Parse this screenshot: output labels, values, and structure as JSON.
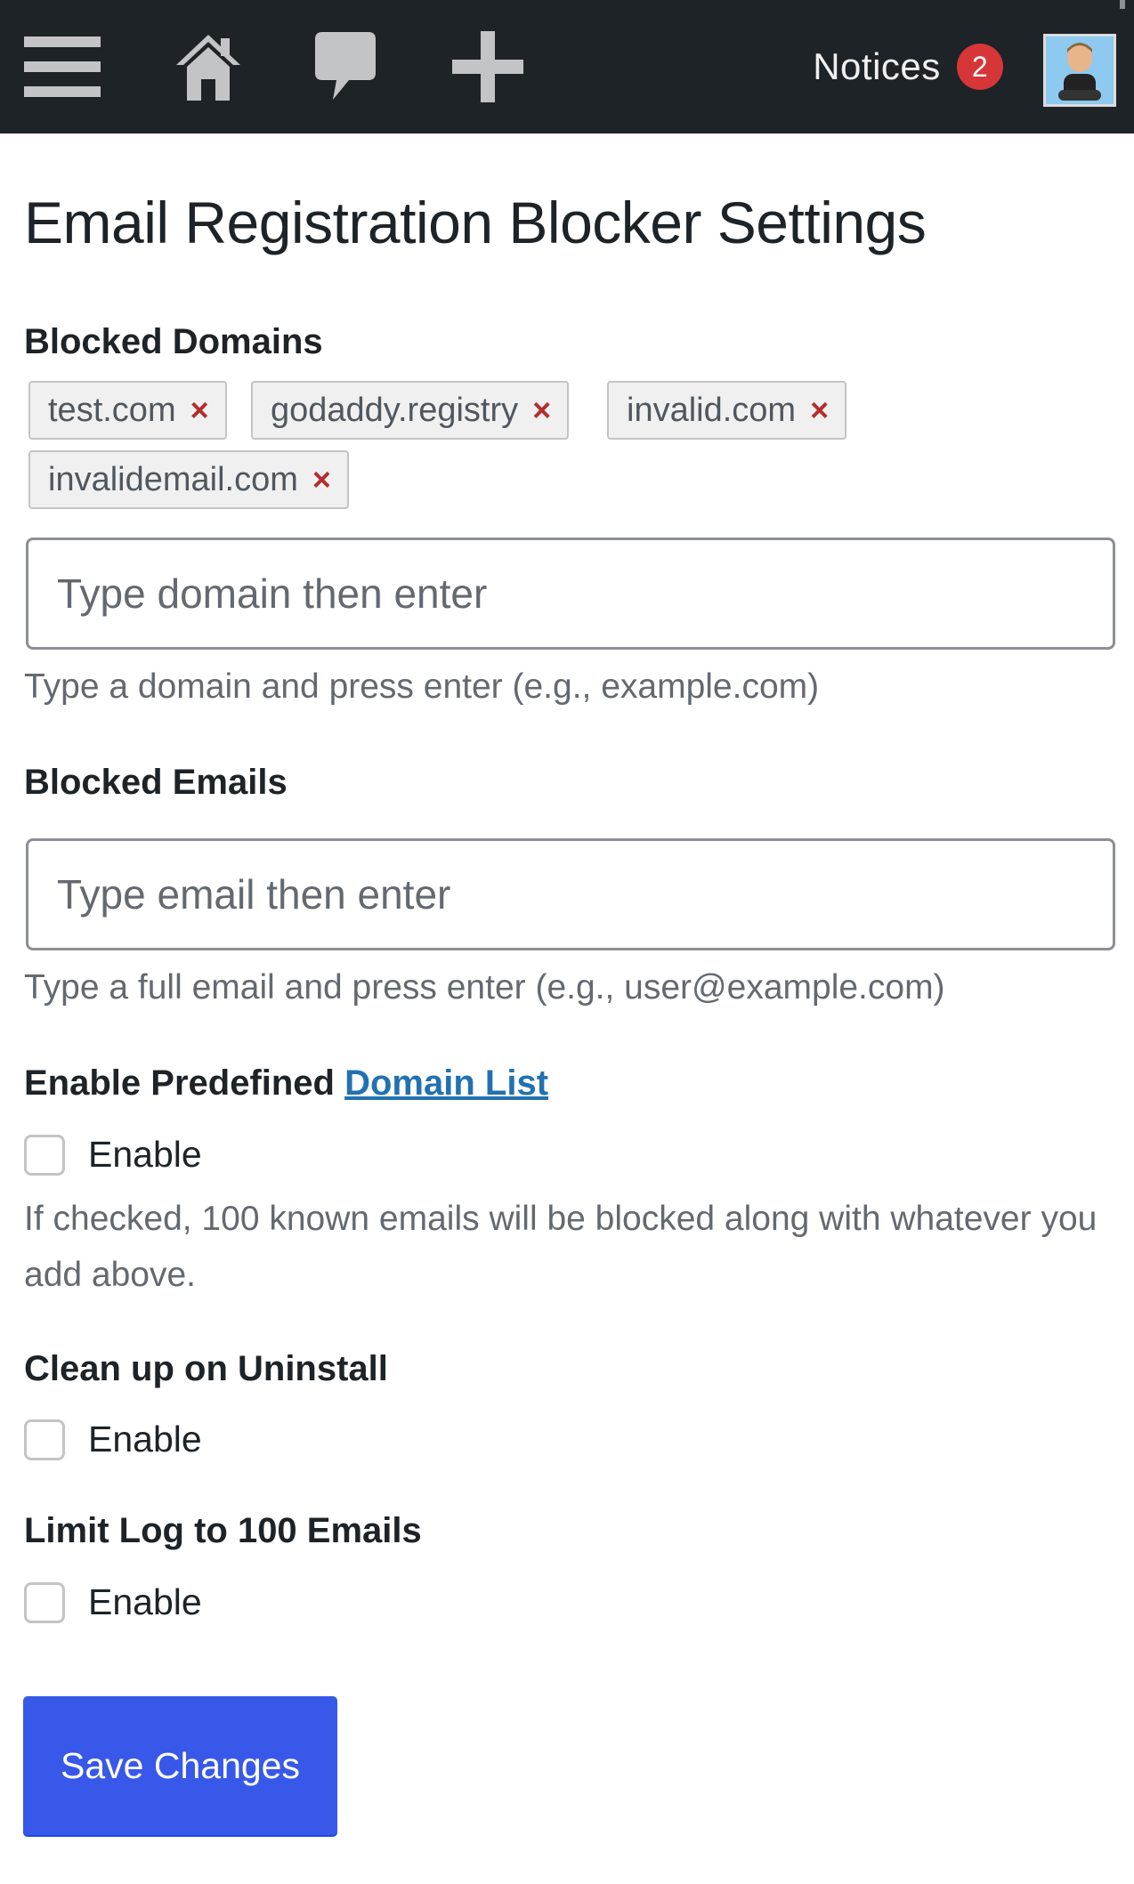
{
  "adminbar": {
    "menu_icon": "hamburger-menu-icon",
    "home_icon": "home-icon",
    "comments_icon": "comment-bubble-icon",
    "new_icon": "plus-icon",
    "notices_label": "Notices",
    "notices_count": "2",
    "avatar_icon": "user-avatar",
    "background": "#1d2327",
    "badge_color": "#d63638"
  },
  "page": {
    "title": "Email Registration Blocker Settings"
  },
  "blocked_domains": {
    "label": "Blocked Domains",
    "tags": [
      "test.com",
      "godaddy.registry",
      "invalid.com",
      "invalidemail.com"
    ],
    "remove_glyph": "×",
    "placeholder": "Type domain then enter",
    "description": "Type a domain and press enter (e.g., example.com)"
  },
  "blocked_emails": {
    "label": "Blocked Emails",
    "placeholder": "Type email then enter",
    "description": "Type a full email and press enter (e.g., user@example.com)"
  },
  "predefined": {
    "label_prefix": "Enable Predefined",
    "link_text": "Domain List",
    "checkbox_label": "Enable",
    "checked": false,
    "description": "If checked, 100 known emails will be blocked along with whatever you add above."
  },
  "cleanup": {
    "label": "Clean up on Uninstall",
    "checkbox_label": "Enable",
    "checked": false
  },
  "limit_log": {
    "label": "Limit Log to 100 Emails",
    "checkbox_label": "Enable",
    "checked": false
  },
  "save": {
    "label": "Save Changes",
    "color": "#3858e9"
  }
}
